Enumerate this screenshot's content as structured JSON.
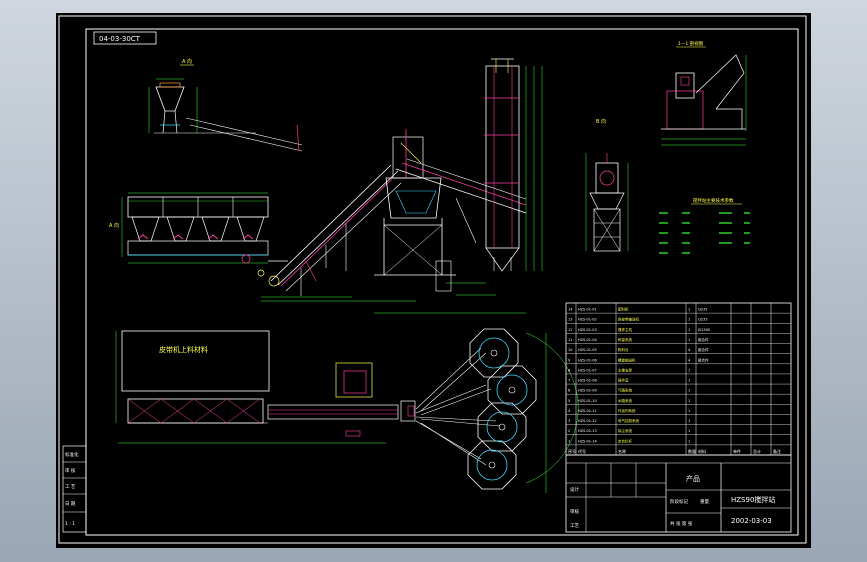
{
  "drawing": {
    "code_tag": "04-03-30CT",
    "view_labels": {
      "side_view": "A 向",
      "section_view": "1—1 剖视图",
      "rear_view": "B 向",
      "left_view": "A 向"
    },
    "plan_area_label": "皮带机上料材料",
    "spec_table_title": "搅拌站主要技术参数"
  },
  "side_table": {
    "rows": [
      "标准化",
      "审 核",
      "工 艺",
      "日 期",
      "1 : 1"
    ]
  },
  "parts_list": {
    "rows": [
      {
        "code": "HZS-01-01",
        "name": "配料机",
        "qty": "1",
        "note": "Q235"
      },
      {
        "code": "HZS-01-02",
        "name": "斜皮带输送机",
        "qty": "1",
        "note": "Q235"
      },
      {
        "code": "HZS-01-03",
        "name": "搅拌主机",
        "qty": "1",
        "note": "JS1500"
      },
      {
        "code": "HZS-01-04",
        "name": "称量系统",
        "qty": "1",
        "note": "组合件"
      },
      {
        "code": "HZS-01-05",
        "name": "粉料仓",
        "qty": "4",
        "note": "组合件"
      },
      {
        "code": "HZS-01-06",
        "name": "螺旋输送机",
        "qty": "4",
        "note": "组合件"
      },
      {
        "code": "HZS-01-07",
        "name": "主楼支架",
        "qty": "1",
        "note": ""
      },
      {
        "code": "HZS-01-08",
        "name": "操作室",
        "qty": "1",
        "note": ""
      },
      {
        "code": "HZS-01-09",
        "name": "气路系统",
        "qty": "1",
        "note": ""
      },
      {
        "code": "HZS-01-10",
        "name": "水路系统",
        "qty": "1",
        "note": ""
      },
      {
        "code": "HZS-01-11",
        "name": "外加剂系统",
        "qty": "1",
        "note": ""
      },
      {
        "code": "HZS-01-12",
        "name": "电气控制系统",
        "qty": "1",
        "note": ""
      },
      {
        "code": "HZS-01-13",
        "name": "除尘系统",
        "qty": "1",
        "note": ""
      },
      {
        "code": "HZS-01-14",
        "name": "走台栏杆",
        "qty": "1",
        "note": ""
      }
    ],
    "header": [
      "序号",
      "代号",
      "名称",
      "数量",
      "材料",
      "单件",
      "总计",
      "备注"
    ]
  },
  "title_block": {
    "unit_label": "产品",
    "product_name": "HZS90搅拌站",
    "date_code": "2002-03-03",
    "row_labels": [
      "标记",
      "处数",
      "分区",
      "更改文件号",
      "签名",
      "年月日"
    ],
    "design_labels": [
      "设计",
      "标准化",
      "阶段标记",
      "重量",
      "比例"
    ],
    "audit_labels": [
      "审核",
      "工艺",
      "批准"
    ],
    "sheet_info": "共 张 第 张"
  },
  "colors": {
    "background": "#000000",
    "frame": "#ffffff",
    "dimension": "#39ff39",
    "structure": "#ffffff",
    "highlight": "#ff3fa4",
    "annotation": "#ffff4c",
    "accent": "#3fd9ff",
    "orange": "#ff9a3a"
  }
}
